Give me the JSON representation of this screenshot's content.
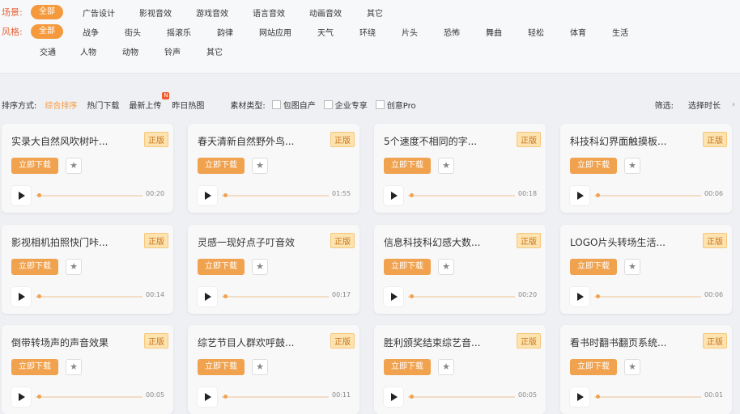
{
  "filters": {
    "scene": {
      "label": "场景:",
      "selected": "全部",
      "options": [
        "广告设计",
        "影视音效",
        "游戏音效",
        "语言音效",
        "动画音效",
        "其它"
      ]
    },
    "style": {
      "label": "风格:",
      "selected": "全部",
      "row1": [
        "战争",
        "街头",
        "摇滚乐",
        "韵律",
        "网站应用",
        "天气",
        "环绕",
        "片头",
        "恐怖",
        "舞曲",
        "轻松",
        "体育",
        "生活"
      ],
      "row2": [
        "交通",
        "人物",
        "动物",
        "铃声",
        "其它"
      ]
    }
  },
  "sortbar": {
    "label": "排序方式:",
    "options": [
      "综合排序",
      "热门下载",
      "最新上传",
      "昨日热图"
    ],
    "new_badge": "N",
    "type_label": "素材类型:",
    "types": [
      "包图自产",
      "企业专享",
      "创意Pro"
    ],
    "filter_label": "筛选:",
    "duration": "选择时长",
    "chevron": "chevron-right-icon"
  },
  "card_labels": {
    "tag": "正版",
    "download": "立即下载"
  },
  "cards": [
    {
      "title": "实录大自然风吹树叶...",
      "duration": "00:20"
    },
    {
      "title": "春天清新自然野外鸟...",
      "duration": "01:55"
    },
    {
      "title": "5个速度不相同的字...",
      "duration": "00:18"
    },
    {
      "title": "科技科幻界面触摸板...",
      "duration": "00:06"
    },
    {
      "title": "影视相机拍照快门咔...",
      "duration": "00:14"
    },
    {
      "title": "灵感一现好点子叮音效",
      "duration": "00:17"
    },
    {
      "title": "信息科技科幻感大数...",
      "duration": "00:20"
    },
    {
      "title": "LOGO片头转场生活...",
      "duration": "00:06"
    },
    {
      "title": "倒带转场声的声音效果",
      "duration": "00:05"
    },
    {
      "title": "综艺节目人群欢呼鼓...",
      "duration": "00:11"
    },
    {
      "title": "胜利颁奖结束综艺音...",
      "duration": "00:05"
    },
    {
      "title": "看书时翻书翻页系统...",
      "duration": "00:01"
    }
  ],
  "colors": {
    "accent": "#f59a3c",
    "label": "#e8643c",
    "tag_bg": "#fde3b0"
  }
}
